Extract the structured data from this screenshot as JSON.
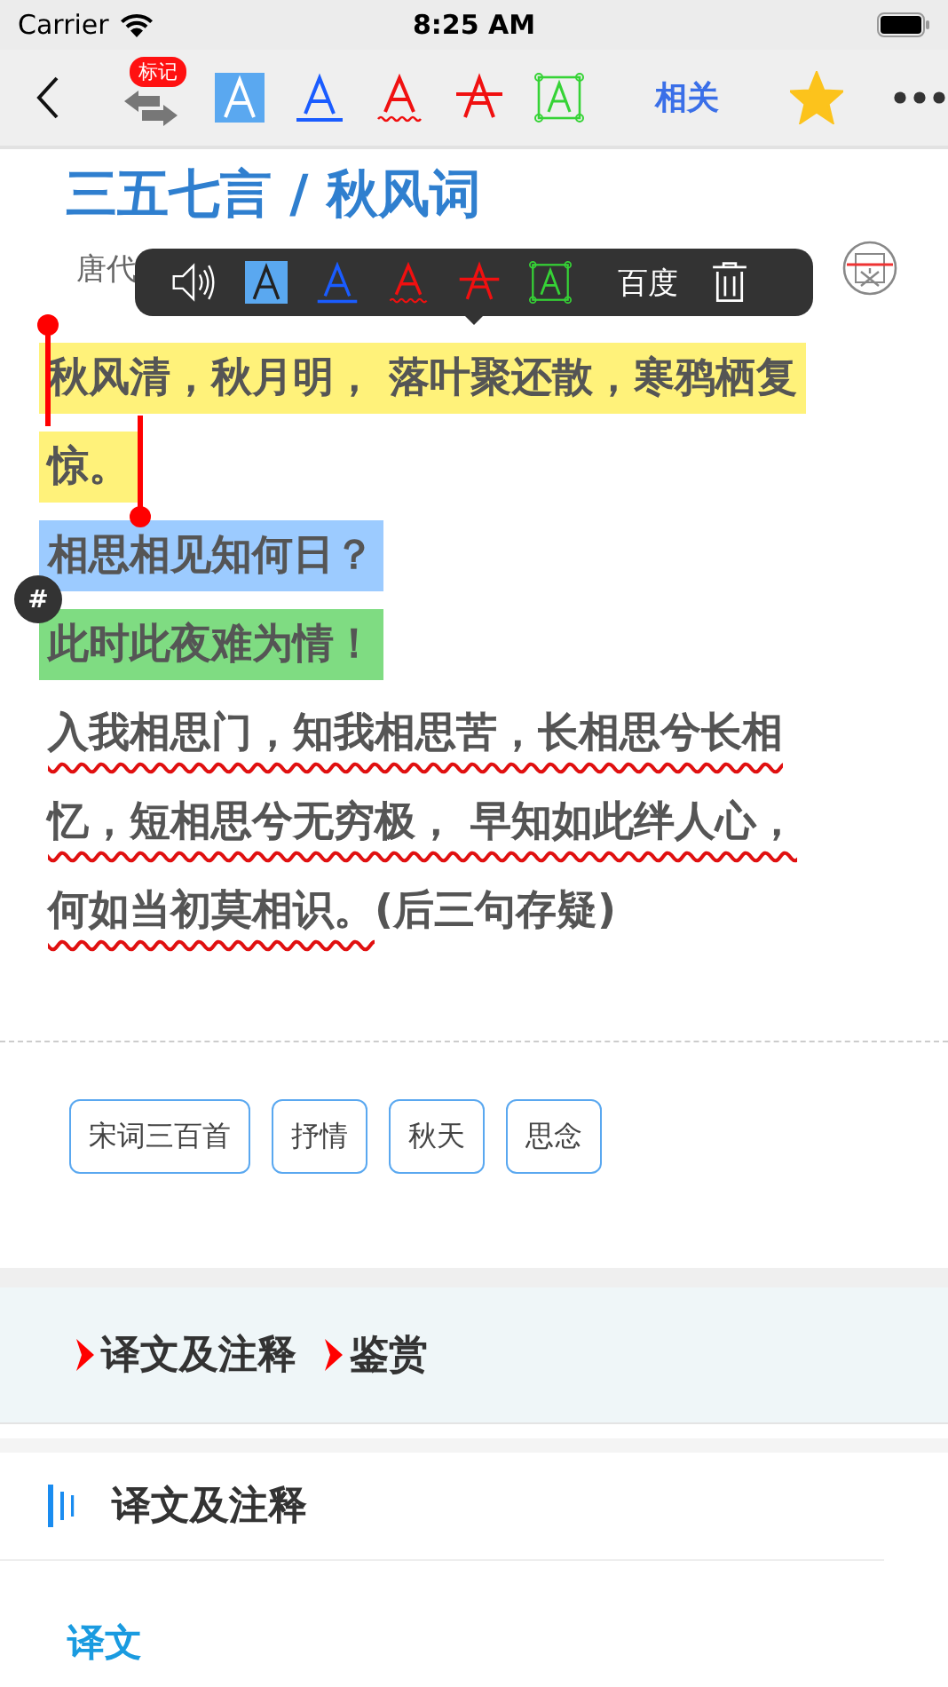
{
  "status_bar": {
    "carrier": "Carrier",
    "time": "8:25 AM"
  },
  "nav": {
    "badge": "标记",
    "related": "相关",
    "favorite": true
  },
  "title": "三五七言 / 秋风词",
  "author": "唐代",
  "popup": {
    "search": "百度"
  },
  "note_badge": "#",
  "poem": [
    {
      "kind": "highlight",
      "color": "#fff27a",
      "text": "秋风清，秋月明， 落叶聚还散，寒鸦栖复"
    },
    {
      "kind": "highlight",
      "color": "#fff27a",
      "text": "惊。"
    },
    {
      "kind": "highlight",
      "color": "#9ccbff",
      "text": "相思相见知何日？"
    },
    {
      "kind": "highlight",
      "color": "#7fdc82",
      "text": "此时此夜难为情！"
    },
    {
      "kind": "wavy",
      "text": "入我相思门，知我相思苦，长相思兮长相"
    },
    {
      "kind": "wavy",
      "text": "忆，短相思兮无穷极， 早知如此绊人心，"
    },
    {
      "kind": "wavy",
      "text": "何如当初莫相识。",
      "note": "(后三句存疑)"
    }
  ],
  "tags": [
    "宋词三百首",
    "抒情",
    "秋天",
    "思念"
  ],
  "jump_links": [
    "译文及注释",
    "鉴赏"
  ],
  "section": {
    "title": "译文及注释",
    "subtitle": "译文"
  }
}
